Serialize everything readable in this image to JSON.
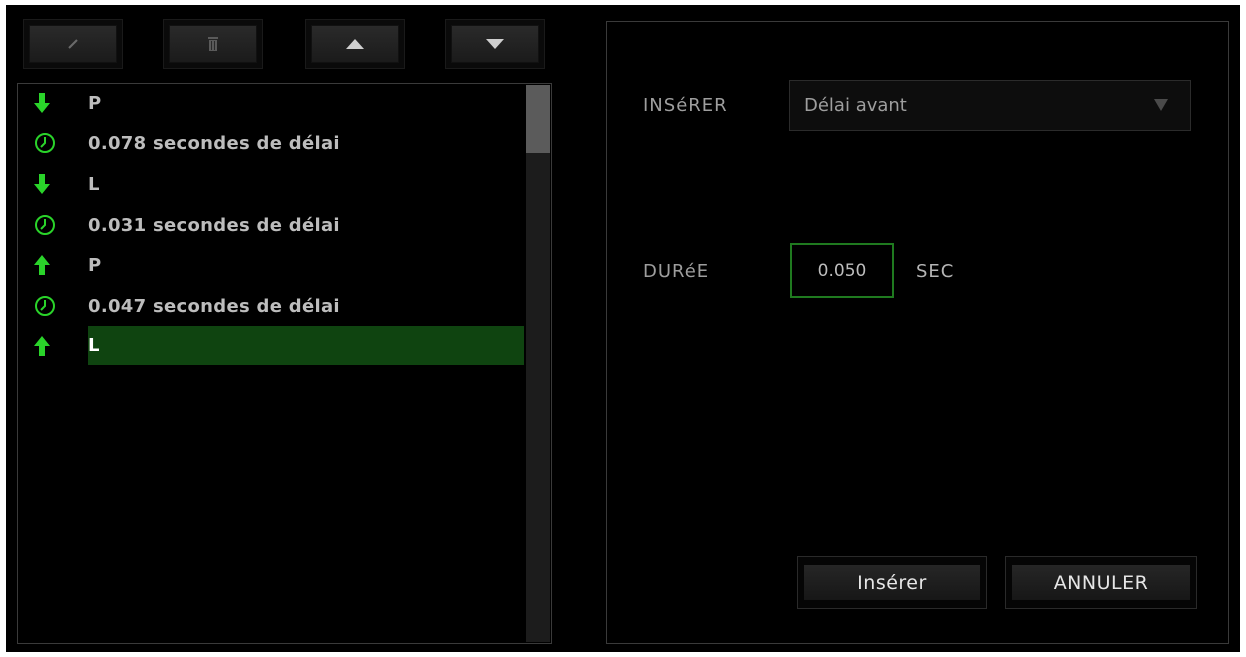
{
  "toolbar": {
    "buttons": [
      {
        "icon": "pencil-icon"
      },
      {
        "icon": "trash-icon"
      },
      {
        "icon": "move-up-icon"
      },
      {
        "icon": "move-down-icon"
      }
    ]
  },
  "macro_list": {
    "items": [
      {
        "type": "key-down",
        "icon": "arrow-down-icon",
        "label": "P",
        "selected": false
      },
      {
        "type": "delay",
        "icon": "clock-icon",
        "label": "0.078 secondes de délai",
        "selected": false
      },
      {
        "type": "key-down",
        "icon": "arrow-down-icon",
        "label": "L",
        "selected": false
      },
      {
        "type": "delay",
        "icon": "clock-icon",
        "label": "0.031 secondes de délai",
        "selected": false
      },
      {
        "type": "key-up",
        "icon": "arrow-up-icon",
        "label": "P",
        "selected": false
      },
      {
        "type": "delay",
        "icon": "clock-icon",
        "label": "0.047 secondes de délai",
        "selected": false
      },
      {
        "type": "key-up",
        "icon": "arrow-up-icon",
        "label": "L",
        "selected": true
      }
    ]
  },
  "insert_panel": {
    "insert_label": "INSéRER",
    "insert_selected": "Délai avant",
    "duration_label": "DURéE",
    "duration_value": "0.050",
    "duration_unit": "SEC",
    "insert_button": "Insérer",
    "cancel_button": "ANNULER"
  },
  "colors": {
    "accent_green": "#2ad42a",
    "selection_bg": "#0f4410",
    "background": "#000000"
  }
}
